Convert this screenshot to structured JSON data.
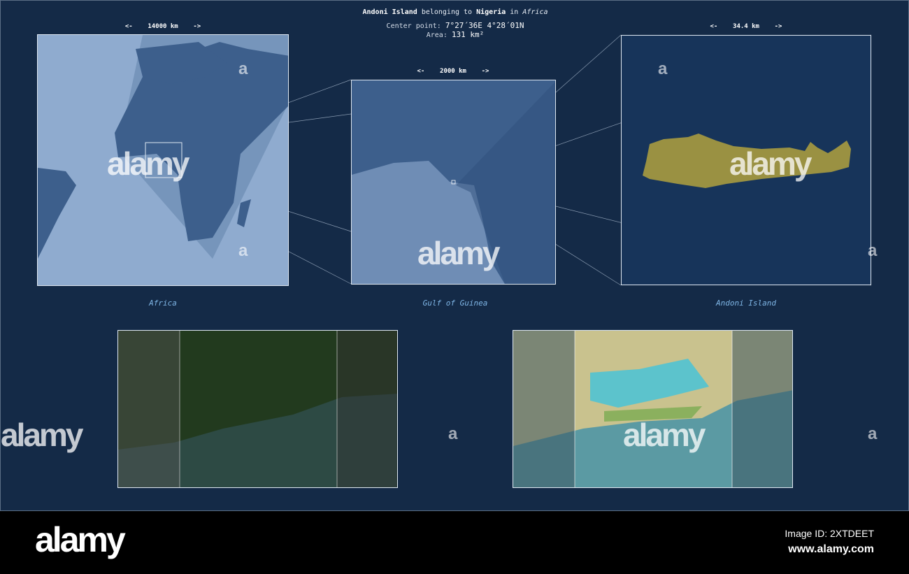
{
  "header": {
    "feature": "Andoni Island",
    "belonging": "belonging to",
    "country": "Nigeria",
    "in": "in",
    "continent": "Africa",
    "center_label": "Center point:",
    "center_value": "7°27´36E  4°28´01N",
    "area_label": "Area:",
    "area_value": "131 km²"
  },
  "panels": [
    {
      "caption": "Africa",
      "scale": "<-    14000 km    ->"
    },
    {
      "caption": "Gulf of Guinea",
      "scale": "<-    2000 km    ->"
    },
    {
      "caption": "Andoni Island",
      "scale": "<-    34.4 km    ->"
    }
  ],
  "watermark": {
    "text": "alamy",
    "small": "a"
  },
  "footer": {
    "logo": "alamy",
    "image_id": "Image ID: 2XTDEET",
    "url": "www.alamy.com"
  },
  "colors": {
    "background": "#142a47",
    "land": "#3d5f8c",
    "ocean": "#8fabcf",
    "island": "#9a9142"
  }
}
